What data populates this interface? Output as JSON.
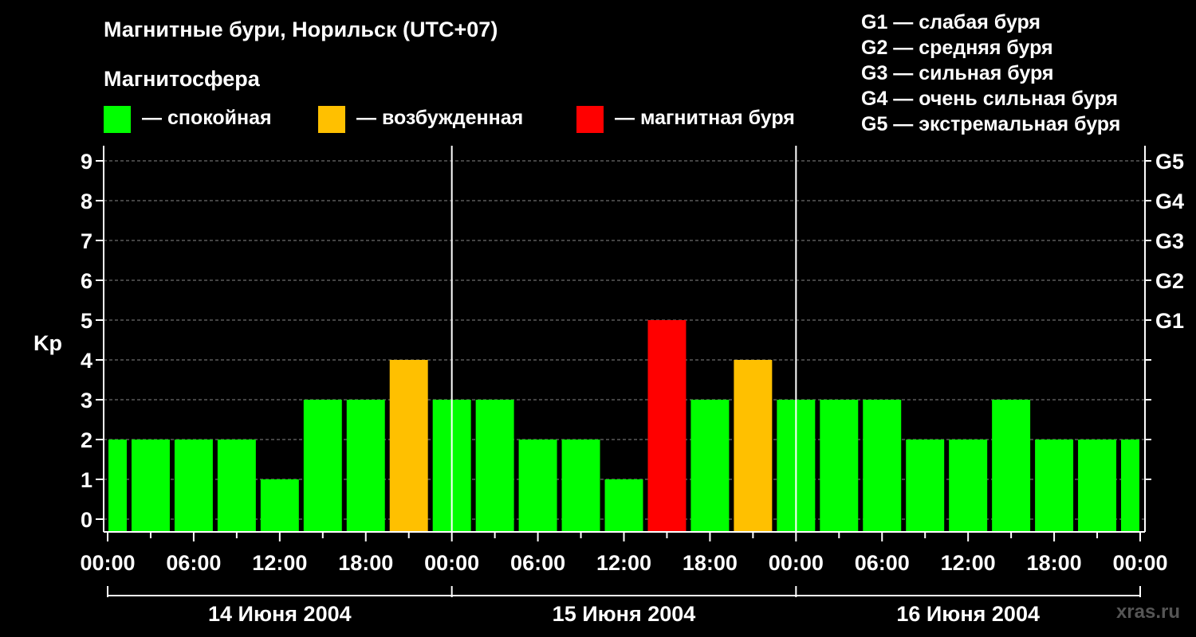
{
  "header": {
    "title": "Магнитные бури, Норильск (UTC+07)",
    "subtitle": "Магнитосфера"
  },
  "legend": [
    {
      "label": "— спокойная",
      "color": "#00ff00"
    },
    {
      "label": "— возбужденная",
      "color": "#ffc000"
    },
    {
      "label": "— магнитная буря",
      "color": "#ff0000"
    }
  ],
  "g_scale": [
    "G1 — слабая буря",
    "G2 — средняя буря",
    "G3 — сильная буря",
    "G4 — очень сильная буря",
    "G5 — экстремальная буря"
  ],
  "watermark": "xras.ru",
  "chart_data": {
    "type": "bar",
    "ylabel": "Kp",
    "ylim": [
      0,
      9
    ],
    "y_ticks": [
      "0",
      "1",
      "2",
      "3",
      "4",
      "5",
      "6",
      "7",
      "8",
      "9"
    ],
    "right_ticks": [
      {
        "value": 5,
        "label": "G1"
      },
      {
        "value": 6,
        "label": "G2"
      },
      {
        "value": 7,
        "label": "G3"
      },
      {
        "value": 8,
        "label": "G4"
      },
      {
        "value": 9,
        "label": "G5"
      }
    ],
    "x_tick_labels": [
      "00:00",
      "06:00",
      "12:00",
      "18:00",
      "00:00",
      "06:00",
      "12:00",
      "18:00",
      "00:00",
      "06:00",
      "12:00",
      "18:00",
      "00:00"
    ],
    "days": [
      "14 Июня 2004",
      "15 Июня 2004",
      "16 Июня 2004"
    ],
    "bin_hours": 3,
    "values": [
      2,
      2,
      2,
      2,
      1,
      3,
      3,
      4,
      3,
      3,
      2,
      2,
      1,
      5,
      3,
      4,
      3,
      3,
      3,
      2,
      2,
      3,
      2,
      2,
      2
    ],
    "colors": {
      "quiet": "#00ff00",
      "active": "#ffc000",
      "storm": "#ff0000"
    },
    "grid": true
  }
}
